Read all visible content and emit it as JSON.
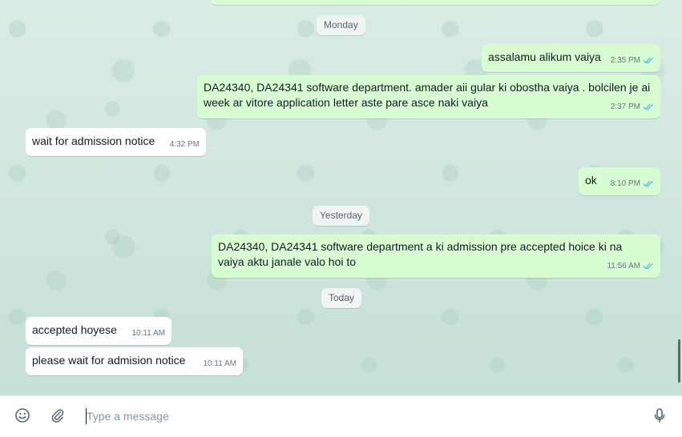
{
  "dates": {
    "monday": "Monday",
    "yesterday": "Yesterday",
    "today": "Today"
  },
  "messages": [
    {
      "dir": "out",
      "text": "assalamu alikum vaiya",
      "time": "2:35 PM",
      "status": "read"
    },
    {
      "dir": "out",
      "text": "DA24340, DA24341 software department. amader aii gular ki obostha vaiya . bolcilen je ai week ar vitore application letter aste pare asce naki vaiya",
      "time": "2:37 PM",
      "status": "read"
    },
    {
      "dir": "in",
      "text": "wait for admission notice",
      "time": "4:32 PM"
    },
    {
      "dir": "out",
      "text": "ok",
      "time": "8:10 PM",
      "status": "read"
    },
    {
      "dir": "out",
      "text": "DA24340, DA24341 software department a ki admission pre accepted hoice ki na vaiya aktu janale valo hoi to",
      "time": "11:56 AM",
      "status": "read"
    },
    {
      "dir": "in",
      "text": "accepted hoyese",
      "time": "10:11 AM"
    },
    {
      "dir": "in",
      "text": "please wait for admision notice",
      "time": "10:11 AM"
    }
  ],
  "composer": {
    "placeholder": "Type a message",
    "value": ""
  },
  "colors": {
    "outgoing_bubble": "#d9fdd3",
    "incoming_bubble": "#ffffff",
    "read_tick": "#53bdeb"
  },
  "icons": [
    "emoji-icon",
    "attach-icon",
    "microphone-icon",
    "double-check-icon"
  ]
}
